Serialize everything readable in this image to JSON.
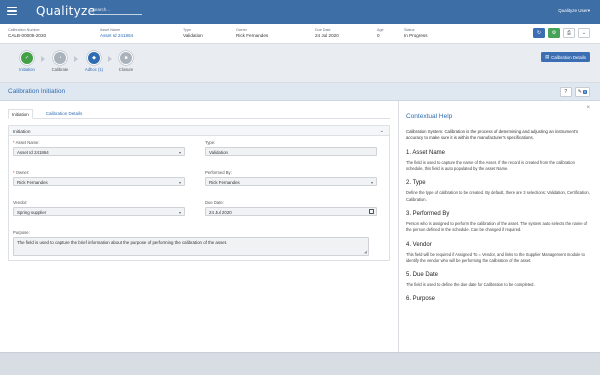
{
  "app": {
    "logo": "Qualityze",
    "search_placeholder": "Search...",
    "user_menu": "Qualityze User▾"
  },
  "record": {
    "fields": [
      {
        "label": "Calibration Number",
        "value": "CALB-00005-2020",
        "link": false
      },
      {
        "label": "Asset Name",
        "value": "Asset Id 241864",
        "link": true
      },
      {
        "label": "Type",
        "value": "Validation",
        "link": false
      },
      {
        "label": "Owner",
        "value": "Rick Fernandes",
        "link": false
      },
      {
        "label": "Due Date",
        "value": "24 Jul 2020",
        "link": false
      },
      {
        "label": "Age",
        "value": "0",
        "link": false
      },
      {
        "label": "Status",
        "value": "In Progress",
        "link": false
      }
    ],
    "buttons": [
      {
        "name": "refresh-icon",
        "glyph": "↻"
      },
      {
        "name": "settings-icon",
        "glyph": "⚙"
      },
      {
        "name": "print-icon",
        "glyph": "⎙"
      },
      {
        "name": "chevron-down-icon",
        "glyph": "⌄"
      }
    ]
  },
  "workflow": {
    "steps": [
      {
        "label": "Initiation",
        "state": "done",
        "glyph": "✓"
      },
      {
        "label": "Calibrate",
        "state": "todo",
        "glyph": "◔"
      },
      {
        "label": "Adhoc (1)",
        "state": "active",
        "glyph": "◆"
      },
      {
        "label": "Closure",
        "state": "todo",
        "glyph": "■"
      }
    ],
    "details_button": "Calibration Details"
  },
  "panel": {
    "title": "Calibration Initiation",
    "help_button": "?",
    "attach_badge": "0",
    "tabs": [
      "Initiation",
      "Calibration Details"
    ],
    "section_title": "Initiation",
    "fields": {
      "asset_name": {
        "label": "Asset Name:",
        "value": "Asset Id 241864"
      },
      "type": {
        "label": "Type:",
        "value": "Validation"
      },
      "owner": {
        "label": "Owner:",
        "value": "Rick Fernandes"
      },
      "performed_by": {
        "label": "Performed By:",
        "value": "Rick Fernandes"
      },
      "vendor": {
        "label": "Vendor:",
        "value": "Spring supplier"
      },
      "due_date": {
        "label": "Due Date:",
        "value": "24 Jul 2020"
      },
      "purpose": {
        "label": "Purpose:",
        "value": "The field is used to capture the brief information about the purpose of performing the calibration of the asset."
      }
    }
  },
  "help": {
    "title": "Contextual Help",
    "intro": "Calibration System: Calibration is the process of determining and adjusting an instrument's accuracy to make sure it is within the manufacturer's specifications.",
    "sections": [
      {
        "heading": "1. Asset Name",
        "text": "The field is used to capture the name of the Asset. If the record is created from the calibration schedule, this field is auto populated by the asset Name."
      },
      {
        "heading": "2. Type",
        "text": "Define the type of calibration to be created. By default, there are 3 selections: Validation, Certification, Calibration."
      },
      {
        "heading": "3. Performed By",
        "text": "Person who is assigned to perform the calibration of the asset. The system auto selects the name of the person defined in the schedule. Can be changed if required."
      },
      {
        "heading": "4. Vendor",
        "text": "This field will be required if Assigned To = Vendor, and links to the Supplier Management module to identify the vendor who will be performing the calibration of the asset."
      },
      {
        "heading": "5. Due Date",
        "text": "The field is used to define the due date for Calibration to be completed."
      },
      {
        "heading": "6. Purpose",
        "text": ""
      }
    ]
  }
}
